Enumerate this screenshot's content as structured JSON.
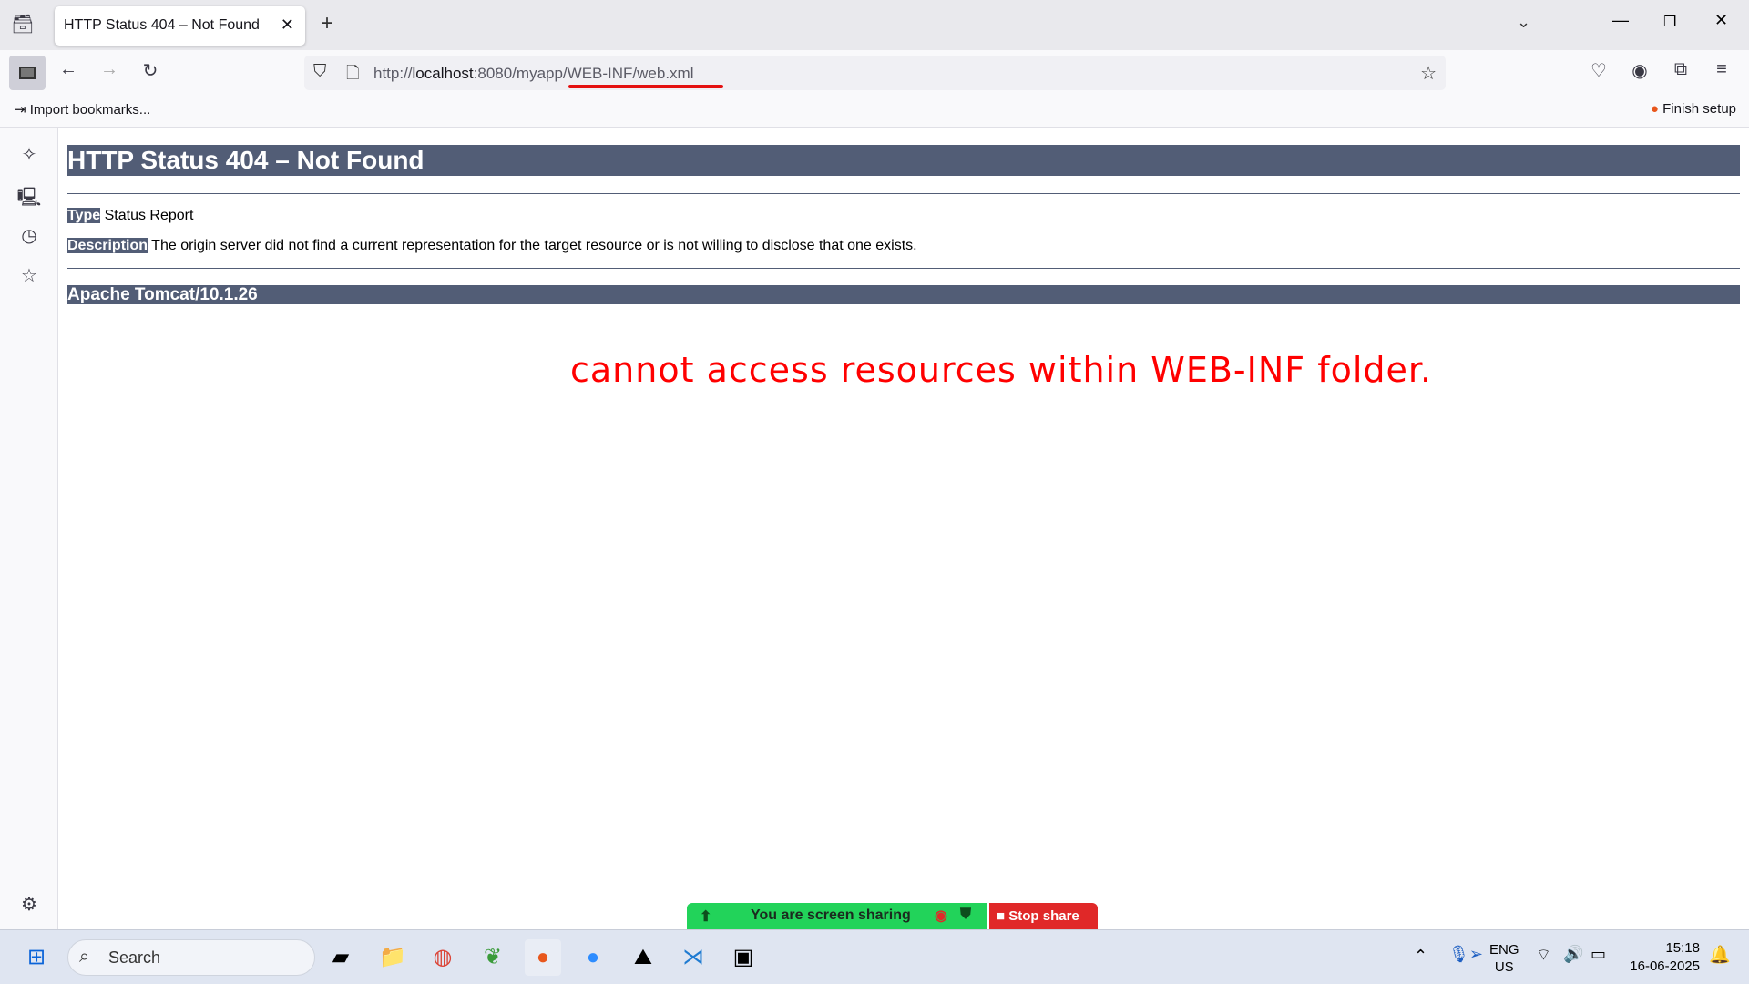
{
  "browser": {
    "tab_title": "HTTP Status 404 – Not Found",
    "url_prefix": "http://",
    "url_host": "localhost",
    "url_rest": ":8080/myapp/WEB-INF/web.xml",
    "import_bookmarks": "Import bookmarks...",
    "finish_setup": "Finish setup"
  },
  "page": {
    "title": "HTTP Status 404 – Not Found",
    "type_label": "Type",
    "type_value": "Status Report",
    "description_label": "Description",
    "description_value": "The origin server did not find a current representation for the target resource or is not willing to disclose that one exists.",
    "footer": "Apache Tomcat/10.1.26"
  },
  "annotation": {
    "text": "cannot access resources within WEB-INF folder.",
    "color": "#ff0000"
  },
  "screen_share": {
    "status": "You are screen sharing",
    "stop": "Stop share"
  },
  "taskbar": {
    "search_placeholder": "Search",
    "lang_top": "ENG",
    "lang_bottom": "US",
    "time": "15:18",
    "date": "16-06-2025"
  },
  "colors": {
    "tomcat_header": "#525d76",
    "share_green": "#22d35a",
    "stop_red": "#e02828"
  }
}
